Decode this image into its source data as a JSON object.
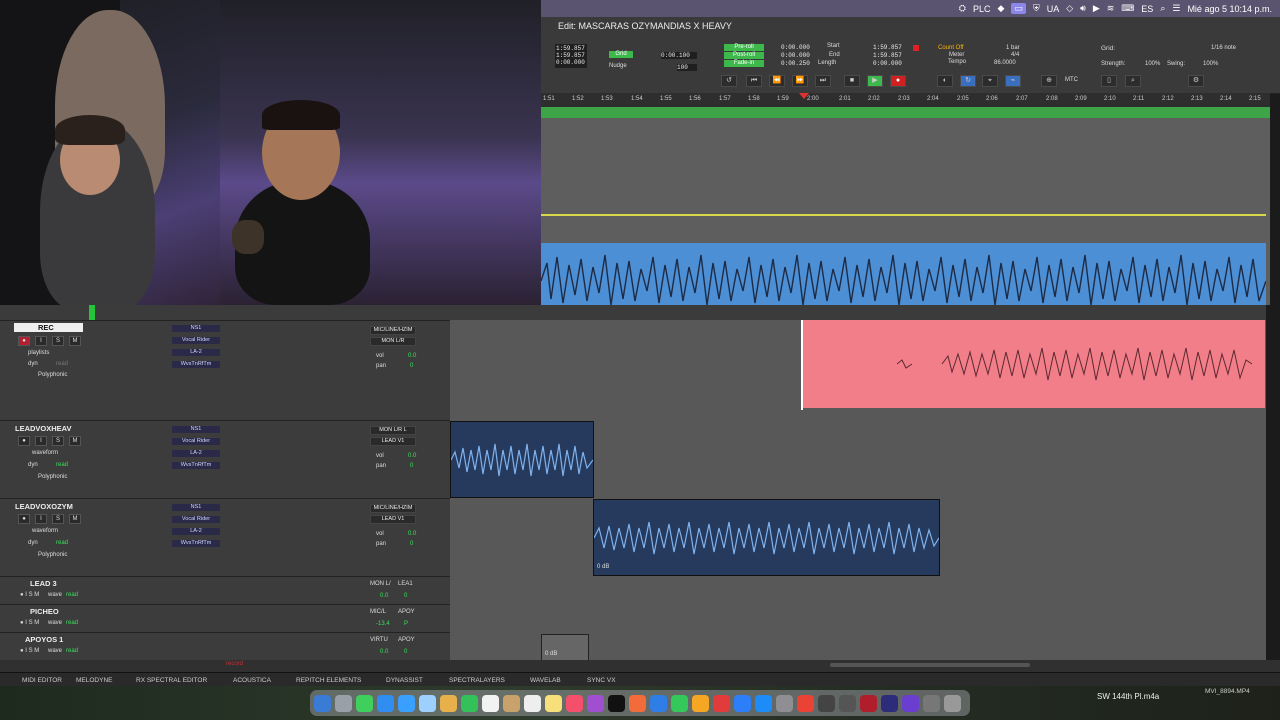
{
  "menubar": {
    "plc": "PLC",
    "ua": "UA",
    "es": "ES",
    "datetime": "Mié ago 5  10:14 p.m."
  },
  "edit_window": {
    "title": "Edit: MASCARAS OZYMANDIAS X HEAVY"
  },
  "counters": {
    "main1": "1:59.857",
    "main2": "1:59.857",
    "main3": "0:00.000",
    "grid_label": "Grid",
    "nudge_label": "Nudge",
    "grid_value": "0:00.100",
    "nudge_value": "100",
    "preroll_label": "Pre-roll",
    "postroll_label": "Post-roll",
    "fadein_label": "Fade-in",
    "preroll": "0:00.000",
    "postroll": "0:00.000",
    "fadein": "0:00.250",
    "start_label": "Start",
    "end_label": "End",
    "length_label": "Length",
    "start": "1:59.857",
    "end": "1:59.857",
    "length": "0:00.000",
    "countoff": "Count Off",
    "countoff_val": "1 bar",
    "meter_label": "Meter",
    "meter": "4/4",
    "tempo_label": "Tempo",
    "tempo": "86.0000",
    "grid2_label": "Grid:",
    "grid2_value": "1/16 note",
    "strength_label": "Strength:",
    "strength": "100%",
    "swing_label": "Swing:",
    "swing": "100%",
    "mtc": "MTC"
  },
  "ruler": [
    "1:51",
    "1:52",
    "1:53",
    "1:54",
    "1:55",
    "1:56",
    "1:57",
    "1:58",
    "1:59",
    "2:00",
    "2:01",
    "2:02",
    "2:03",
    "2:04",
    "2:05",
    "2:06",
    "2:07",
    "2:08",
    "2:09",
    "2:10",
    "2:11",
    "2:12",
    "2:13",
    "2:14",
    "2:15"
  ],
  "tracks": [
    {
      "name": "REC",
      "view": "playlists",
      "sub1": "dyn",
      "sub2": "read",
      "alg": "Polyphonic",
      "inserts": [
        "NS1",
        "Vocal Rider",
        "LA-2",
        "WvsTnRfTm"
      ],
      "io1": "MIC/LINE/HZIM",
      "io2": "MON L/R",
      "vol": "0.0",
      "pan": "0"
    },
    {
      "name": "LEADVOXHEAV",
      "view": "waveform",
      "sub1": "dyn",
      "sub2": "read",
      "alg": "Polyphonic",
      "inserts": [
        "NS1",
        "Vocal Rider",
        "LA-2",
        "WvsTnRfTm"
      ],
      "io1": "MON L/R L",
      "io2": "LEAD V1",
      "vol": "0.0",
      "pan": "0"
    },
    {
      "name": "LEADVOXOZYM",
      "view": "waveform",
      "sub1": "dyn",
      "sub2": "read",
      "alg": "Polyphonic",
      "inserts": [
        "NS1",
        "Vocal Rider",
        "LA-2",
        "WvsTnRfTm"
      ],
      "io1": "MIC/LINE/HZIM",
      "io2": "LEAD V1",
      "vol": "0.0",
      "pan": "0"
    },
    {
      "name": "LEAD 3",
      "view": "wave",
      "sub2": "read",
      "io1": "MON L/",
      "io2": "LEA1",
      "vol": "0.0",
      "pan": "0"
    },
    {
      "name": "PICHEO",
      "view": "wave",
      "sub2": "read",
      "io1": "MIC/L",
      "io2": "APOY",
      "vol": "-13.4",
      "pan": "P"
    },
    {
      "name": "APOYOS 1",
      "view": "wave",
      "sub2": "read",
      "io1": "VIRTU",
      "io2": "APOY",
      "vol": "0.0",
      "pan": "0"
    }
  ],
  "clip_gain": {
    "clipB": "0 dB",
    "clipC": "0 dB"
  },
  "record_label": "record",
  "plugin_bar": [
    "MIDI EDITOR",
    "MELODYNE",
    "RX SPECTRAL EDITOR",
    "ACOUSTICA",
    "REPITCH ELEMENTS",
    "DYNASSIST",
    "SPECTRALAYERS",
    "WAVELAB",
    "SYNC VX"
  ],
  "dock_file": "SW 144th Pl.m4a",
  "dock_file2": "MVI_8894.MP4"
}
